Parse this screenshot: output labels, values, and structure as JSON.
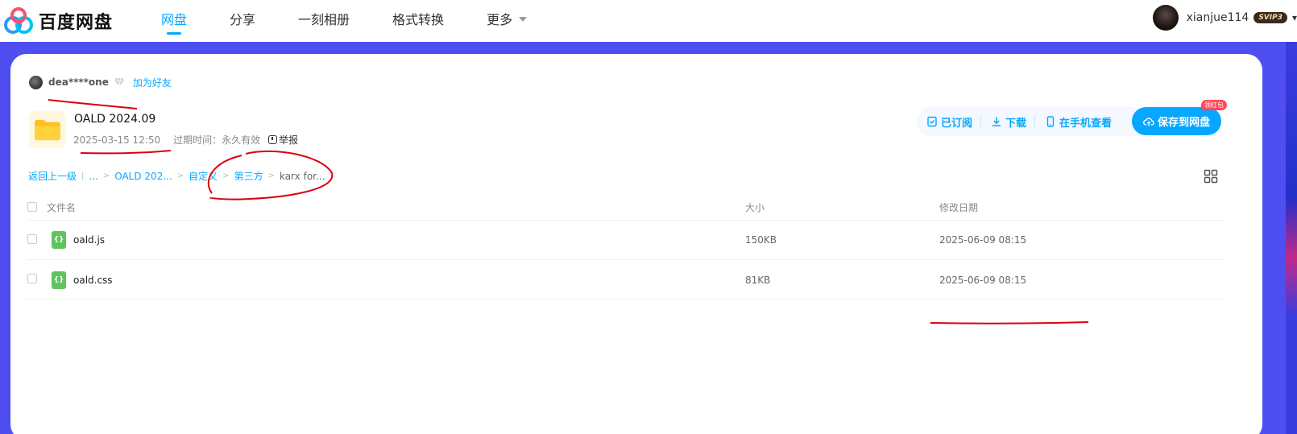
{
  "app": {
    "logo_text": "百度网盘"
  },
  "nav": {
    "items": [
      {
        "label": "网盘",
        "active": true
      },
      {
        "label": "分享"
      },
      {
        "label": "一刻相册"
      },
      {
        "label": "格式转换"
      },
      {
        "label": "更多"
      }
    ]
  },
  "user": {
    "name": "xianjue114",
    "badge": "SVIP3"
  },
  "share": {
    "sharer_name": "dea****one",
    "add_friend": "加为好友",
    "folder_title": "OALD 2024.09",
    "date": "2025-03-15 12:50",
    "expiry": "过期时间：永久有效",
    "report": "举报"
  },
  "actions": {
    "subscribed": "已订阅",
    "download": "下载",
    "mobile_view": "在手机查看",
    "save": "保存到网盘",
    "redpack": "领红包"
  },
  "breadcrumb": {
    "back": "返回上一级",
    "ellipsis": "...",
    "items": [
      "OALD 202...",
      "自定义",
      "第三方"
    ],
    "current": "karx for..."
  },
  "table": {
    "headers": {
      "name": "文件名",
      "size": "大小",
      "modified": "修改日期"
    },
    "rows": [
      {
        "name": "oald.js",
        "size": "150KB",
        "modified": "2025-06-09 08:15",
        "icon": "code-file-icon"
      },
      {
        "name": "oald.css",
        "size": "81KB",
        "modified": "2025-06-09 08:15",
        "icon": "code-file-icon"
      }
    ]
  },
  "colors": {
    "accent": "#06a7ff",
    "background": "#4f4ef0",
    "annotation": "#d9000f"
  }
}
